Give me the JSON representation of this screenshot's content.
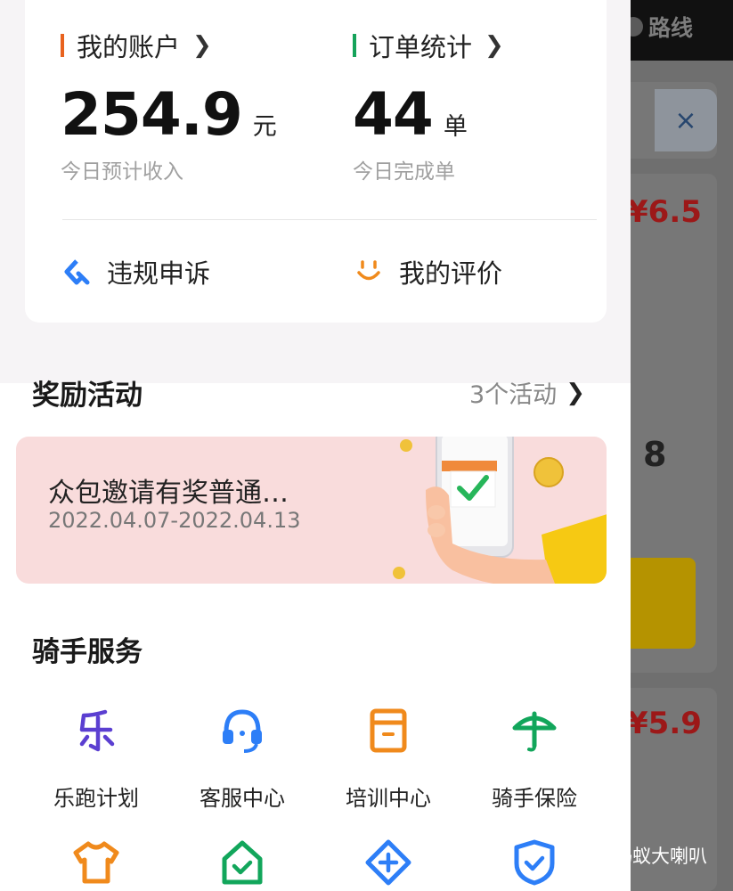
{
  "background": {
    "route_label": "路线",
    "close_symbol": "×",
    "price_1": "¥6.5",
    "number_8": "8",
    "price_2": "¥5.9",
    "watermark": "蚂蚁大喇叭"
  },
  "account": {
    "label": "我的账户",
    "amount": "254.9",
    "unit": "元",
    "sub": "今日预计收入",
    "bar_color": "#e8621e"
  },
  "orders": {
    "label": "订单统计",
    "amount": "44",
    "unit": "单",
    "sub": "今日完成单",
    "bar_color": "#15a35a"
  },
  "links": {
    "appeal": "违规申诉",
    "rating": "我的评价"
  },
  "rewards": {
    "title": "奖励活动",
    "more": "3个活动",
    "banner_title": "众包邀请有奖普通…",
    "banner_date": "2022.04.07-2022.04.13"
  },
  "services": {
    "title": "骑手服务",
    "items": [
      {
        "label": "乐跑计划",
        "icon": "le-run-icon",
        "color": "#5b3fd1"
      },
      {
        "label": "客服中心",
        "icon": "headset-icon",
        "color": "#2d7ef7"
      },
      {
        "label": "培训中心",
        "icon": "training-box-icon",
        "color": "#f08a1c"
      },
      {
        "label": "骑手保险",
        "icon": "umbrella-icon",
        "color": "#12a65b"
      }
    ],
    "row2_icons": [
      {
        "icon": "shirt-icon",
        "color": "#f08a1c"
      },
      {
        "icon": "house-check-icon",
        "color": "#12a65b"
      },
      {
        "icon": "plus-diamond-icon",
        "color": "#2d7ef7"
      },
      {
        "icon": "shield-check-icon",
        "color": "#2d7ef7"
      }
    ]
  }
}
